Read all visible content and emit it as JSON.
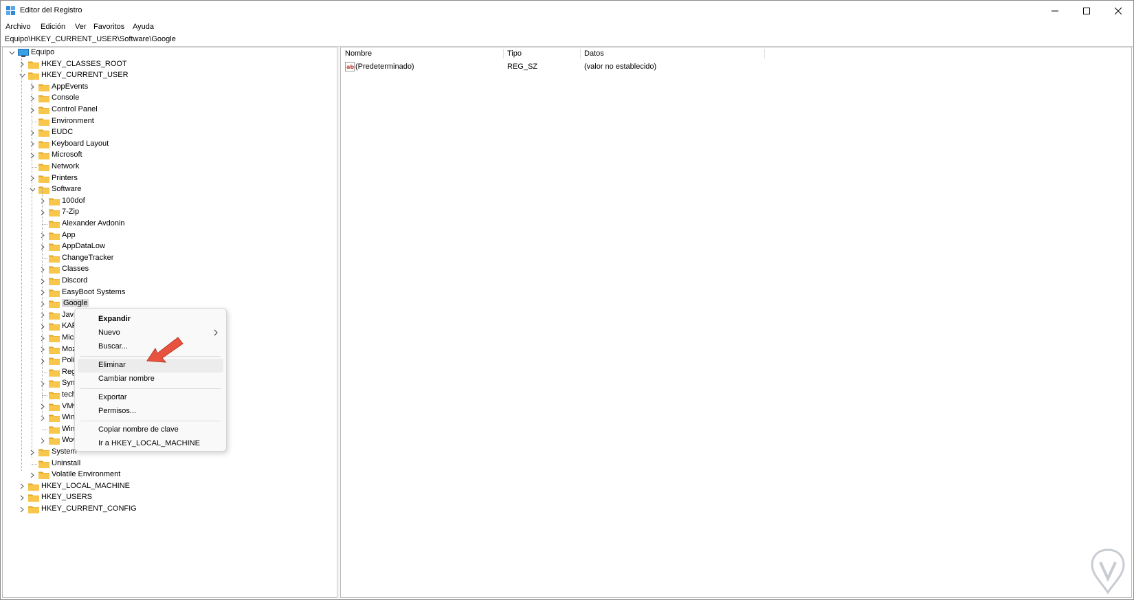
{
  "window": {
    "title": "Editor del Registro",
    "controls": [
      "minimize-icon",
      "maximize-icon",
      "close-icon"
    ]
  },
  "menu": [
    "Archivo",
    "Edición",
    "Ver",
    "Favoritos",
    "Ayuda"
  ],
  "address": "Equipo\\HKEY_CURRENT_USER\\Software\\Google",
  "tree": {
    "root": "Equipo",
    "hkcr": "HKEY_CLASSES_ROOT",
    "hkcu": "HKEY_CURRENT_USER",
    "hkcu_children": [
      "AppEvents",
      "Console",
      "Control Panel",
      "Environment",
      "EUDC",
      "Keyboard Layout",
      "Microsoft",
      "Network",
      "Printers",
      "Software"
    ],
    "software_children": [
      "100dof",
      "7-Zip",
      "Alexander Avdonin",
      "App",
      "AppDataLow",
      "ChangeTracker",
      "Classes",
      "Discord",
      "EasyBoot Systems",
      "Google",
      "Java",
      "KAR",
      "Micr",
      "Moz",
      "Polic",
      "Regi",
      "Sync",
      "tech",
      "VMv",
      "Winl",
      "Winl",
      "Wov"
    ],
    "hkcu_tail": [
      "System",
      "Uninstall",
      "Volatile Environment"
    ],
    "hklm": "HKEY_LOCAL_MACHINE",
    "hku": "HKEY_USERS",
    "hkcc": "HKEY_CURRENT_CONFIG"
  },
  "list": {
    "columns": [
      "Nombre",
      "Tipo",
      "Datos"
    ],
    "rows": [
      {
        "name": "(Predeterminado)",
        "type": "REG_SZ",
        "data": "(valor no establecido)"
      }
    ]
  },
  "context_menu": {
    "expand": "Expandir",
    "new": "Nuevo",
    "find": "Buscar...",
    "delete": "Eliminar",
    "rename": "Cambiar nombre",
    "export": "Exportar",
    "permissions": "Permisos...",
    "copy_key": "Copiar nombre de clave",
    "goto": "Ir a HKEY_LOCAL_MACHINE"
  },
  "colors": {
    "folder": "#f8c64a",
    "folder_dark": "#e0a526",
    "arrow": "#e8533f",
    "selection": "#d9d9d9",
    "menu_hover": "#ececec"
  }
}
